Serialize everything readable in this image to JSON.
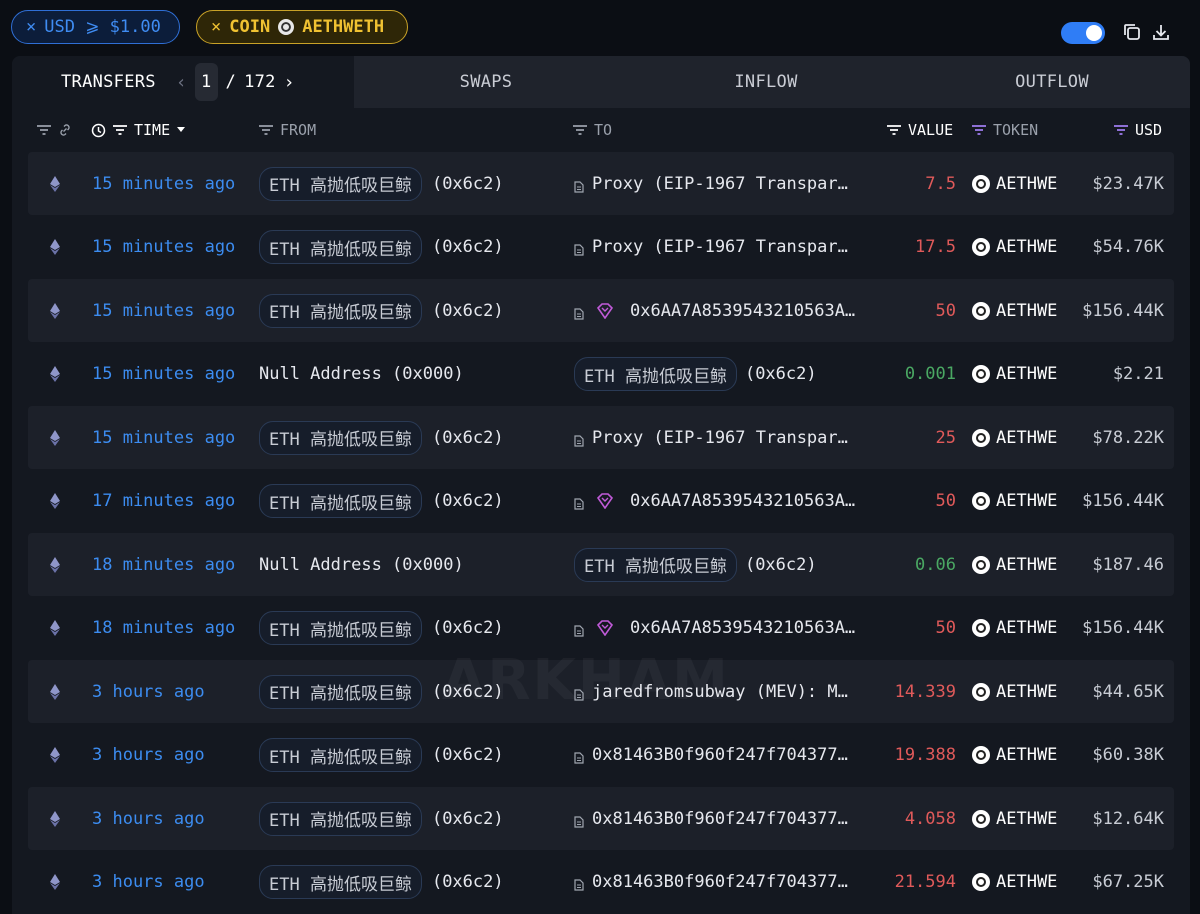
{
  "filters": {
    "usd": {
      "label": "USD ⩾ $1.00",
      "x": "×"
    },
    "coin": {
      "prefix": "COIN",
      "token": "AETHWETH",
      "x": "×"
    }
  },
  "tabs": {
    "transfers": "TRANSFERS",
    "page_current": "1",
    "page_sep": "/",
    "page_total": "172",
    "swaps": "SWAPS",
    "inflow": "INFLOW",
    "outflow": "OUTFLOW"
  },
  "columns": {
    "time": "TIME",
    "from": "FROM",
    "to": "TO",
    "value": "VALUE",
    "token": "TOKEN",
    "usd": "USD"
  },
  "watermark": "ARKHAM",
  "rows": [
    {
      "time": "15 minutes ago",
      "from_entity": "ETH 高抛低吸巨鲸",
      "from_addr": "(0x6c2)",
      "to_type": "contract",
      "to_text": "Proxy (EIP-1967 Transpar…",
      "value": "7.5",
      "value_color": "red",
      "token": "AETHWE",
      "usd": "$23.47K"
    },
    {
      "time": "15 minutes ago",
      "from_entity": "ETH 高抛低吸巨鲸",
      "from_addr": "(0x6c2)",
      "to_type": "contract",
      "to_text": "Proxy (EIP-1967 Transpar…",
      "value": "17.5",
      "value_color": "red",
      "token": "AETHWE",
      "usd": "$54.76K"
    },
    {
      "time": "15 minutes ago",
      "from_entity": "ETH 高抛低吸巨鲸",
      "from_addr": "(0x6c2)",
      "to_type": "gem",
      "to_text": "0x6AA7A8539543210563A…",
      "value": "50",
      "value_color": "red",
      "token": "AETHWE",
      "usd": "$156.44K"
    },
    {
      "time": "15 minutes ago",
      "from_text": "Null Address (0x000)",
      "to_type": "entity",
      "to_entity": "ETH 高抛低吸巨鲸",
      "to_addr": "(0x6c2)",
      "value": "0.001",
      "value_color": "green",
      "token": "AETHWE",
      "usd": "$2.21"
    },
    {
      "time": "15 minutes ago",
      "from_entity": "ETH 高抛低吸巨鲸",
      "from_addr": "(0x6c2)",
      "to_type": "contract",
      "to_text": "Proxy (EIP-1967 Transpar…",
      "value": "25",
      "value_color": "red",
      "token": "AETHWE",
      "usd": "$78.22K"
    },
    {
      "time": "17 minutes ago",
      "from_entity": "ETH 高抛低吸巨鲸",
      "from_addr": "(0x6c2)",
      "to_type": "gem",
      "to_text": "0x6AA7A8539543210563A…",
      "value": "50",
      "value_color": "red",
      "token": "AETHWE",
      "usd": "$156.44K"
    },
    {
      "time": "18 minutes ago",
      "from_text": "Null Address (0x000)",
      "to_type": "entity",
      "to_entity": "ETH 高抛低吸巨鲸",
      "to_addr": "(0x6c2)",
      "value": "0.06",
      "value_color": "green",
      "token": "AETHWE",
      "usd": "$187.46"
    },
    {
      "time": "18 minutes ago",
      "from_entity": "ETH 高抛低吸巨鲸",
      "from_addr": "(0x6c2)",
      "to_type": "gem",
      "to_text": "0x6AA7A8539543210563A…",
      "value": "50",
      "value_color": "red",
      "token": "AETHWE",
      "usd": "$156.44K"
    },
    {
      "time": "3 hours ago",
      "from_entity": "ETH 高抛低吸巨鲸",
      "from_addr": "(0x6c2)",
      "to_type": "contract",
      "to_text": "jaredfromsubway (MEV): M…",
      "value": "14.339",
      "value_color": "red",
      "token": "AETHWE",
      "usd": "$44.65K"
    },
    {
      "time": "3 hours ago",
      "from_entity": "ETH 高抛低吸巨鲸",
      "from_addr": "(0x6c2)",
      "to_type": "contract",
      "to_text": "0x81463B0f960f247f704377…",
      "value": "19.388",
      "value_color": "red",
      "token": "AETHWE",
      "usd": "$60.38K"
    },
    {
      "time": "3 hours ago",
      "from_entity": "ETH 高抛低吸巨鲸",
      "from_addr": "(0x6c2)",
      "to_type": "contract",
      "to_text": "0x81463B0f960f247f704377…",
      "value": "4.058",
      "value_color": "red",
      "token": "AETHWE",
      "usd": "$12.64K"
    },
    {
      "time": "3 hours ago",
      "from_entity": "ETH 高抛低吸巨鲸",
      "from_addr": "(0x6c2)",
      "to_type": "contract",
      "to_text": "0x81463B0f960f247f704377…",
      "value": "21.594",
      "value_color": "red",
      "token": "AETHWE",
      "usd": "$67.25K"
    }
  ]
}
